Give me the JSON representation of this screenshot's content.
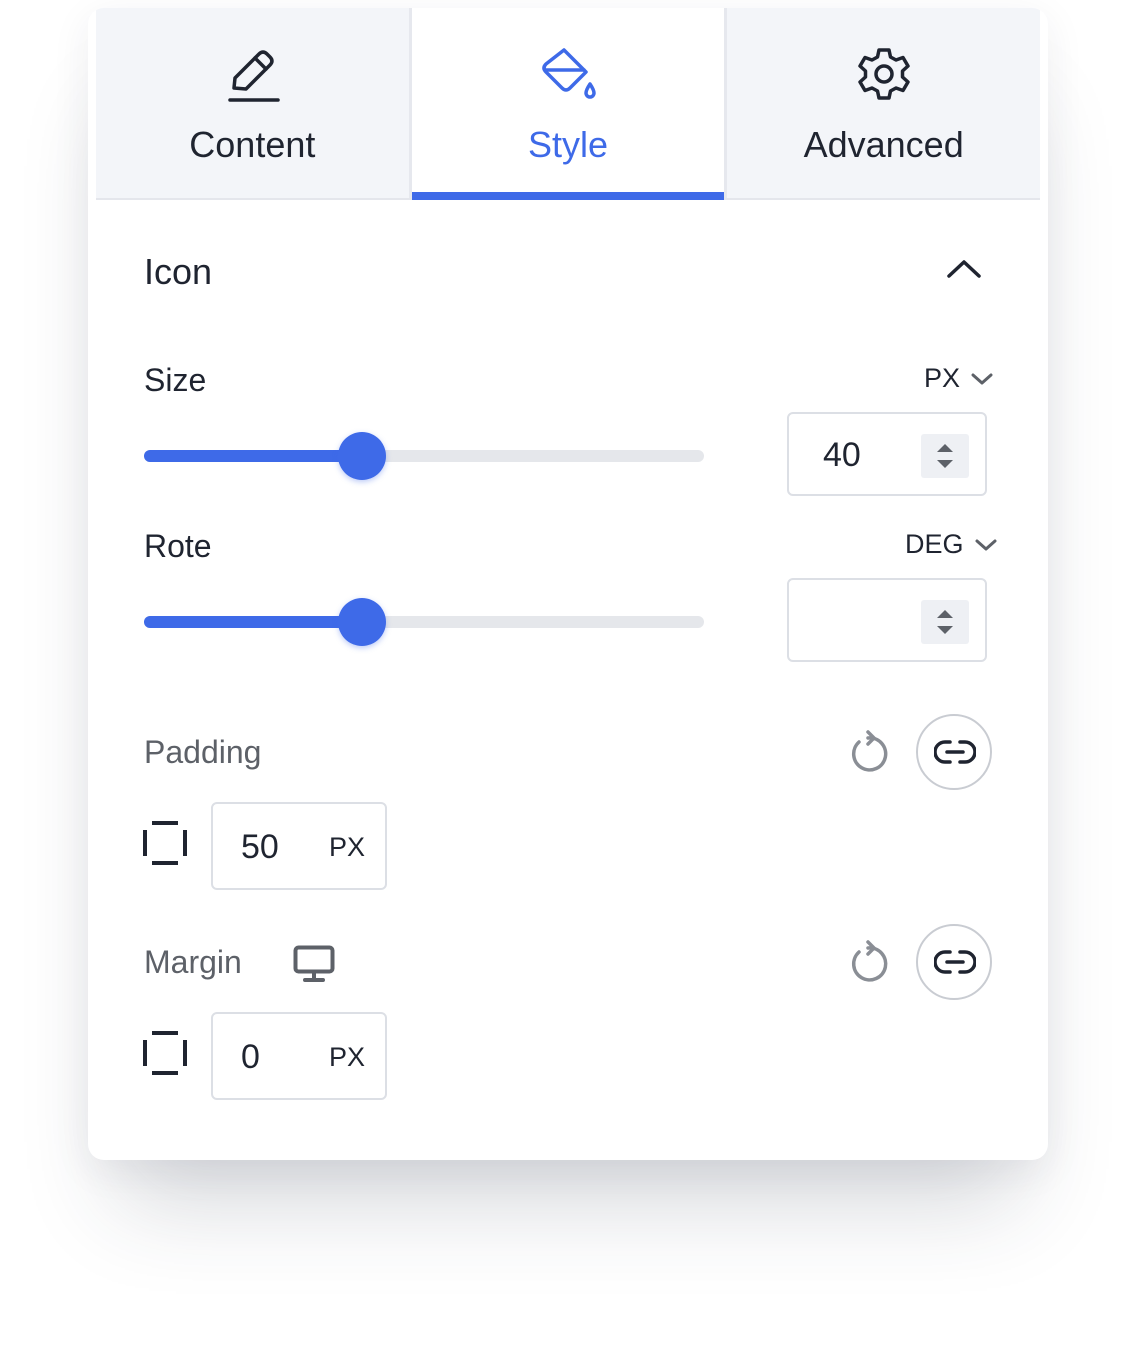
{
  "tabs": [
    {
      "label": "Content",
      "icon": "pencil-icon",
      "active": false
    },
    {
      "label": "Style",
      "icon": "paint-bucket-icon",
      "active": true
    },
    {
      "label": "Advanced",
      "icon": "gear-icon",
      "active": false
    }
  ],
  "accent_color": "#3e6ae8",
  "section": {
    "title": "Icon",
    "collapse_icon": "chevron-up-icon"
  },
  "size": {
    "label": "Size",
    "unit": "PX",
    "value": "40",
    "slider_fraction": 0.39
  },
  "rotate": {
    "label": "Rote",
    "unit": "DEG",
    "value": "",
    "slider_fraction": 0.39
  },
  "padding": {
    "label": "Padding",
    "value": "50",
    "unit": "PX"
  },
  "margin": {
    "label": "Margin",
    "value": "0",
    "unit": "PX",
    "device_icon": "desktop-icon"
  }
}
